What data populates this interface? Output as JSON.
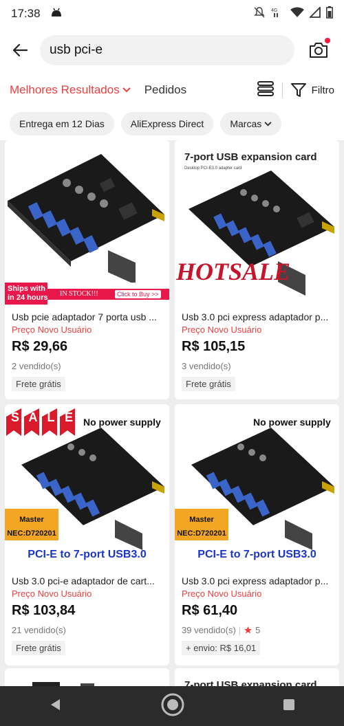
{
  "status": {
    "time": "17:38"
  },
  "search": {
    "query": "usb pci-e"
  },
  "sort": {
    "best": "Melhores Resultados",
    "orders": "Pedidos",
    "filter": "Filtro"
  },
  "chips": [
    "Entrega em 12 Dias",
    "AliExpress Direct",
    "Marcas"
  ],
  "products": [
    {
      "img_texts": {
        "ship1": "Ships with",
        "ship2": "in 24 hours",
        "stock": "IN STOCK!!!",
        "click": "Click to Buy >>"
      },
      "title": "Usb pcie adaptador 7 porta usb ...",
      "promo": "Preço Novo Usuário",
      "price": "R$ 29,66",
      "sold": "2  vendido(s)",
      "tag": "Frete grátis"
    },
    {
      "img_texts": {
        "heading": "7-port USB expansion card",
        "sub": "Desktop PCI-E3.0 adapter card",
        "hot": "HOTSALE"
      },
      "title": "Usb 3.0 pci express adaptador p...",
      "promo": "Preço Novo Usuário",
      "price": "R$ 105,15",
      "sold": "3  vendido(s)",
      "tag": "Frete grátis"
    },
    {
      "img_texts": {
        "sale": [
          "S",
          "A",
          "L",
          "E"
        ],
        "power": "No power supply",
        "master": "Master",
        "nec": "NEC:D720201",
        "bottom": "PCI-E to 7-port USB3.0"
      },
      "title": "Usb 3.0 pci-e adaptador de cart...",
      "promo": "Preço Novo Usuário",
      "price": "R$ 103,84",
      "sold": "21  vendido(s)",
      "tag": "Frete grátis"
    },
    {
      "img_texts": {
        "power": "No power supply",
        "master": "Master",
        "nec": "NEC:D720201",
        "bottom": "PCI-E to 7-port USB3.0"
      },
      "title": "Usb 3.0 pci express adaptador p...",
      "promo": "Preço Novo Usuário",
      "price": "R$ 61,40",
      "sold": "39  vendido(s)",
      "rating": "5",
      "tag": "+ envio: R$ 16,01"
    }
  ],
  "partial": {
    "heading": "7-port USB expansion card"
  },
  "colors": {
    "accent": "#ee3f3f",
    "navbar": "#2b2b2b",
    "blue_text": "#1a35c9"
  }
}
